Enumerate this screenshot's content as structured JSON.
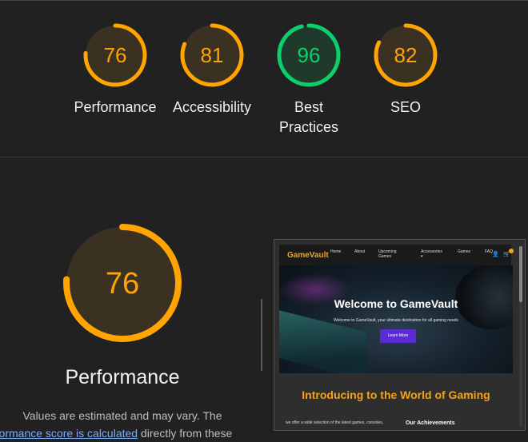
{
  "colors": {
    "good": "#0cce6b",
    "average": "#ffa400",
    "good_fill": "#1f3a2a",
    "average_fill": "#3a3123"
  },
  "categories": [
    {
      "name": "Performance",
      "score": 76,
      "status": "average"
    },
    {
      "name": "Accessibility",
      "score": 81,
      "status": "average"
    },
    {
      "name": "Best Practices",
      "score": 96,
      "status": "good"
    },
    {
      "name": "SEO",
      "score": 82,
      "status": "average"
    }
  ],
  "detail": {
    "score": 76,
    "title": "Performance",
    "desc_line1": "Values are estimated and may vary. The",
    "desc_line2_prefix": "rformance score is calculated",
    "desc_line2_suffix": " directly from these"
  },
  "screenshot": {
    "logo": "GameVault",
    "nav": [
      "Home",
      "About",
      "Upcoming Games",
      "Accessories ▾",
      "Games",
      "FAQ"
    ],
    "icons": [
      "user-icon",
      "cart-icon"
    ],
    "hero_title": "Welcome to GameVault",
    "hero_sub": "Welcome to GameVault, your ultimate destination for all gaming needs",
    "hero_button": "Learn More",
    "intro_title": "Introducing to the World of Gaming",
    "intro_text": "we offer a wide selection of the latest games, consoles,",
    "achievements": "Our Achievements"
  }
}
